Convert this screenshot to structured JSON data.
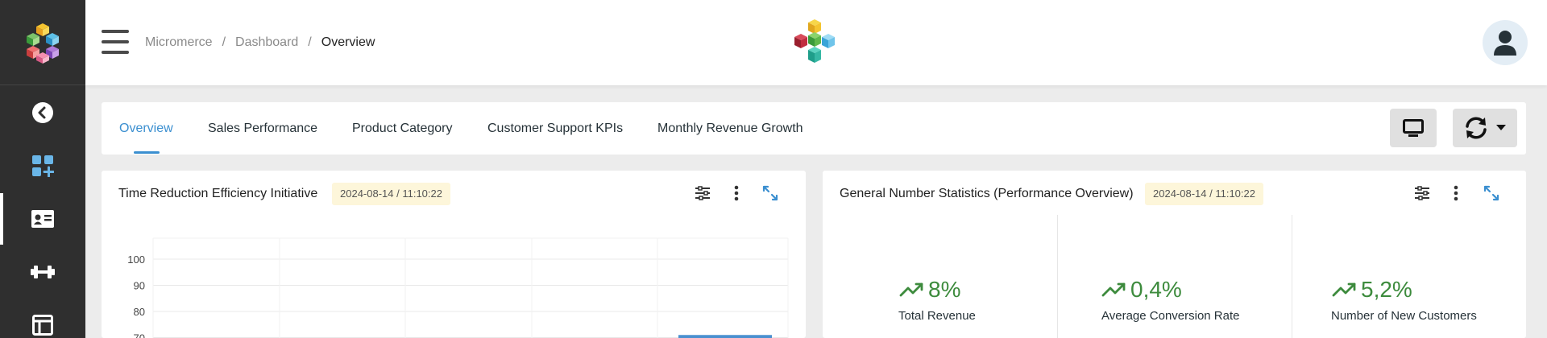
{
  "breadcrumb": {
    "items": [
      "Micromerce",
      "Dashboard",
      "Overview"
    ]
  },
  "tabs": [
    {
      "label": "Overview",
      "active": true
    },
    {
      "label": "Sales Performance"
    },
    {
      "label": "Product Category"
    },
    {
      "label": "Customer Support KPIs"
    },
    {
      "label": "Monthly Revenue Growth"
    }
  ],
  "toolbar": {
    "display_icon": "monitor-icon",
    "refresh_icon": "refresh-icon",
    "dropdown_icon": "caret-down-icon"
  },
  "sidebar": {
    "items": [
      {
        "icon": "back-arrow-icon"
      },
      {
        "icon": "add-widget-icon"
      },
      {
        "icon": "id-card-icon",
        "active": true
      },
      {
        "icon": "dumbbell-icon"
      },
      {
        "icon": "layout-icon"
      }
    ]
  },
  "cards": {
    "left": {
      "title": "Time Reduction Efficiency Initiative",
      "date": "2024-08-14 / 11:10:22"
    },
    "right": {
      "title": "General Number Statistics (Performance Overview)",
      "date": "2024-08-14 / 11:10:22"
    }
  },
  "chart_data": {
    "type": "bar",
    "title": "",
    "ytick_labels": [
      "100",
      "90",
      "80",
      "70"
    ],
    "ylim": [
      70,
      100
    ],
    "values": [
      71
    ],
    "note": "Only the top of the chart is visible; one bar is partially visible at the lower right."
  },
  "stats": [
    {
      "value": "8%",
      "label": "Total Revenue",
      "trend": "up"
    },
    {
      "value": "0,4%",
      "label": "Average Conversion Rate",
      "trend": "up"
    },
    {
      "value": "5,2%",
      "label": "Number of New Customers",
      "trend": "up"
    }
  ],
  "colors": {
    "accent": "#3b8fd0",
    "positive": "#3d8b3d",
    "sidebar": "#2f2f2f",
    "date_badge": "#fdf6da"
  }
}
